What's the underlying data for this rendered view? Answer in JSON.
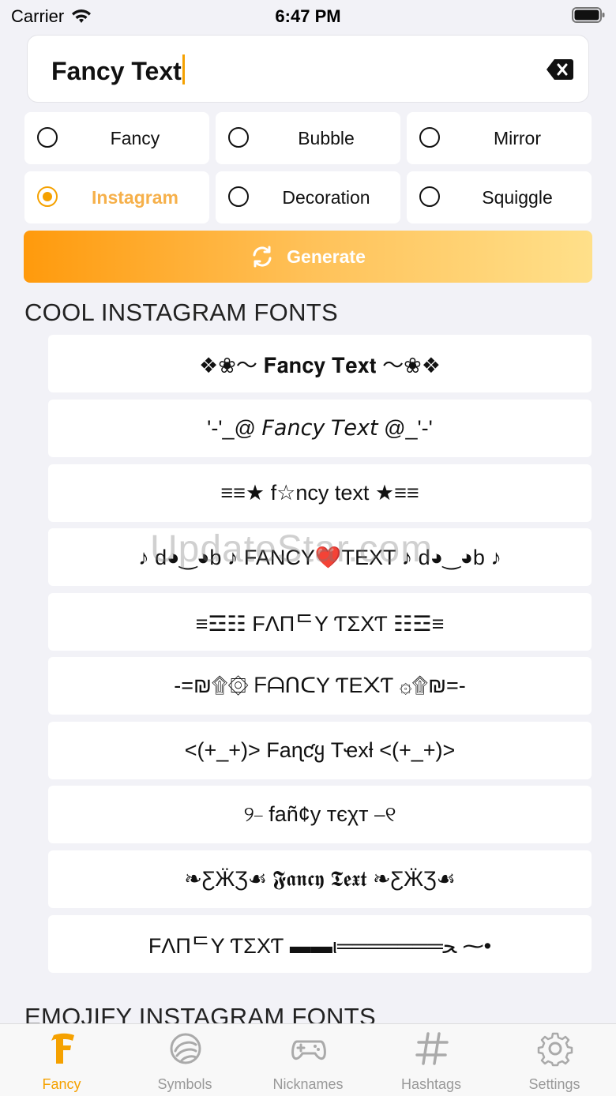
{
  "status_bar": {
    "carrier": "Carrier",
    "time": "6:47 PM"
  },
  "input": {
    "value": "Fancy Text"
  },
  "options": [
    {
      "label": "Fancy",
      "selected": false
    },
    {
      "label": "Bubble",
      "selected": false
    },
    {
      "label": "Mirror",
      "selected": false
    },
    {
      "label": "Instagram",
      "selected": true
    },
    {
      "label": "Decoration",
      "selected": false
    },
    {
      "label": "Squiggle",
      "selected": false
    }
  ],
  "generate_label": "Generate",
  "sections": {
    "cool_title": "COOL INSTAGRAM FONTS",
    "emojify_title": "EMOJIFY INSTAGRAM FONTS"
  },
  "font_rows": [
    "❖❀〜 𝐅𝐚𝐧𝐜𝐲 𝐓𝐞𝐱𝐭 〜❀❖",
    "'-'_@ 𝘍𝘢𝘯𝘤𝘺 𝘛𝘦𝘹𝘵 @_'-'",
    "≡≡★ f☆ncy text ★≡≡",
    "♪ d◕‿◕b ♪ FANCY❤️TEXT ♪ d◕‿◕b ♪",
    "≡☲☷ FΛПᄃY ƬΣXƬ ☷☲≡",
    "-=₪۩۞ ᖴᗩᑎᑕY ƬE᙭Ƭ ۞۩₪=-",
    "<(+_+)> Faɳƈყ Tҽxƚ <(+_+)>",
    "୨⎯ fañ¢y тєχт ⎯୧",
    "❧ƸӜƷ☙ 𝕱𝖆𝖓𝖈𝖞 𝕿𝖊𝖝𝖙 ❧ƸӜƷ☙",
    "FΛПᄃY ƬΣXƬ ▬▬ι═══════ﺤ ⁓•"
  ],
  "watermark": "UpdateStar.com",
  "tabs": [
    {
      "label": "Fancy",
      "icon": "fancy-f-icon",
      "active": true
    },
    {
      "label": "Symbols",
      "icon": "symbols-swirl-icon",
      "active": false
    },
    {
      "label": "Nicknames",
      "icon": "gamepad-icon",
      "active": false
    },
    {
      "label": "Hashtags",
      "icon": "hashtag-icon",
      "active": false
    },
    {
      "label": "Settings",
      "icon": "gear-icon",
      "active": false
    }
  ],
  "colors": {
    "accent": "#f5a100",
    "background": "#f2f2f7",
    "inactive_tab": "#999999"
  }
}
